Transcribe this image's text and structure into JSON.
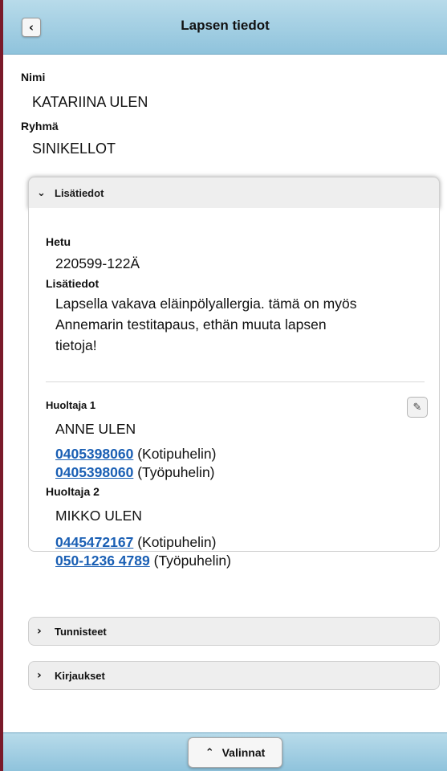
{
  "header": {
    "title": "Lapsen tiedot",
    "back_icon": "chevron-left-icon"
  },
  "child": {
    "name_label": "Nimi",
    "name_value": "KATARIINA ULEN",
    "group_label": "Ryhmä",
    "group_value": "SINIKELLOT"
  },
  "details_panel": {
    "title": "Lisätiedot",
    "state": "expanded",
    "hetu_label": "Hetu",
    "hetu_value": "220599-122Ä",
    "info_label": "Lisätiedot",
    "info_lines": [
      "Lapsella vakava eläinpölyallergia. tämä on myös",
      "Annemarin testitapaus, ethän muuta lapsen",
      "tietoja!"
    ],
    "guardians": [
      {
        "label": "Huoltaja 1",
        "name": "ANNE ULEN",
        "phones": [
          {
            "number": "0405398060",
            "type": "(Kotipuhelin)"
          },
          {
            "number": "0405398060",
            "type": "(Työpuhelin)"
          }
        ]
      },
      {
        "label": "Huoltaja 2",
        "name": "MIKKO ULEN",
        "phones": [
          {
            "number": "0445472167",
            "type": "(Kotipuhelin)"
          },
          {
            "number": "050-1236 4789",
            "type": "(Työpuhelin)"
          }
        ]
      }
    ]
  },
  "collapsed_panels": [
    {
      "title": "Tunnisteet"
    },
    {
      "title": "Kirjaukset"
    }
  ],
  "footer": {
    "menu_label": "Valinnat"
  },
  "colors": {
    "header_bg": "#a6d0e4",
    "link": "#1a5fb4",
    "panel_header_bg": "#eeeeee"
  }
}
